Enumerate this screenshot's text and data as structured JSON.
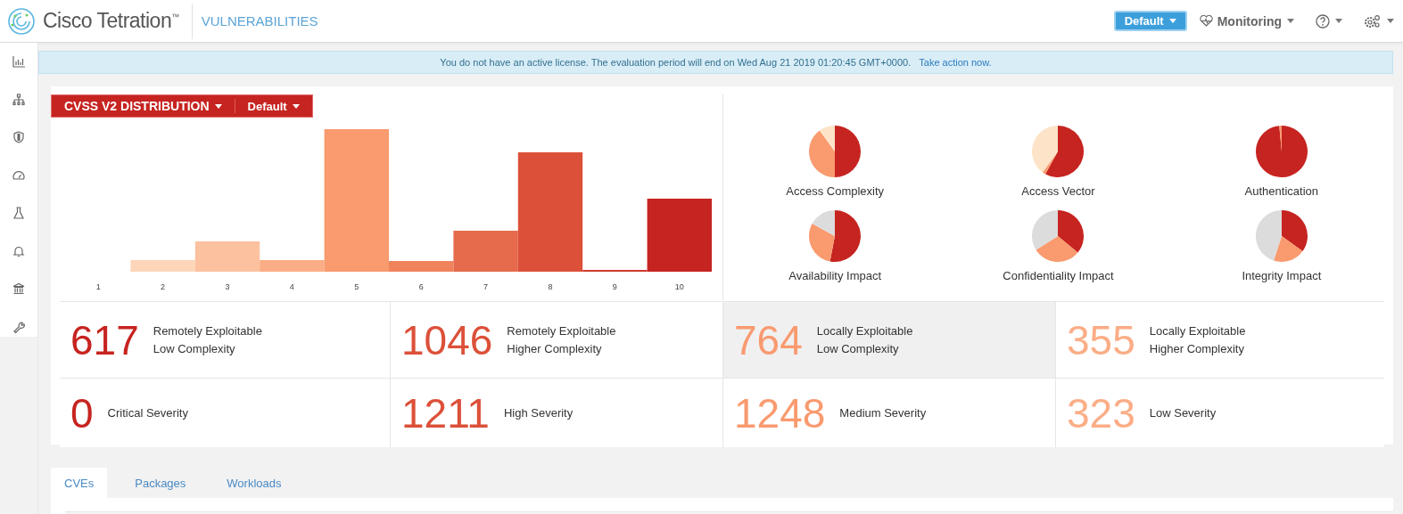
{
  "header": {
    "brand": "Cisco Tetration",
    "trademark": "™",
    "page_title": "VULNERABILITIES",
    "scope_button": "Default",
    "monitoring": "Monitoring"
  },
  "sidebar": {
    "items": [
      {
        "kind": "chart"
      },
      {
        "kind": "tree"
      },
      {
        "kind": "shield"
      },
      {
        "kind": "gauge"
      },
      {
        "kind": "flask"
      },
      {
        "kind": "bell"
      },
      {
        "kind": "bank"
      },
      {
        "kind": "wrench"
      }
    ]
  },
  "banner": {
    "message": "You do not have an active license. The evaluation period will end on Wed Aug 21 2019 01:20:45 GMT+0000.",
    "link": "Take action now."
  },
  "distribution": {
    "title": "CVSS V2 DISTRIBUTION",
    "filter": "Default",
    "bar_labels": [
      "1",
      "2",
      "3",
      "4",
      "5",
      "6",
      "7",
      "8",
      "9",
      "10"
    ],
    "pies": [
      {
        "label": "Access Complexity"
      },
      {
        "label": "Access Vector"
      },
      {
        "label": "Authentication"
      },
      {
        "label": "Availability Impact"
      },
      {
        "label": "Confidentiality Impact"
      },
      {
        "label": "Integrity Impact"
      }
    ],
    "stats": [
      {
        "value": "617",
        "label_lines": [
          "Remotely Exploitable",
          "Low Complexity"
        ],
        "color": "#c62420",
        "highlighted": false
      },
      {
        "value": "1046",
        "label_lines": [
          "Remotely Exploitable",
          "Higher Complexity"
        ],
        "color": "#dc5039",
        "highlighted": false
      },
      {
        "value": "764",
        "label_lines": [
          "Locally Exploitable",
          "Low Complexity"
        ],
        "color": "#f99a6f",
        "highlighted": true
      },
      {
        "value": "355",
        "label_lines": [
          "Locally Exploitable",
          "Higher Complexity"
        ],
        "color": "#fbad86",
        "highlighted": false
      },
      {
        "value": "0",
        "label_lines": [
          "Critical Severity"
        ],
        "color": "#c62420",
        "highlighted": false
      },
      {
        "value": "1211",
        "label_lines": [
          "High Severity"
        ],
        "color": "#dc5039",
        "highlighted": false
      },
      {
        "value": "1248",
        "label_lines": [
          "Medium Severity"
        ],
        "color": "#f99a6f",
        "highlighted": false
      },
      {
        "value": "323",
        "label_lines": [
          "Low Severity"
        ],
        "color": "#fbad86",
        "highlighted": false
      }
    ]
  },
  "tabs": [
    {
      "label": "CVEs",
      "selected": true
    },
    {
      "label": "Packages",
      "selected": false
    },
    {
      "label": "Workloads",
      "selected": false
    }
  ]
}
